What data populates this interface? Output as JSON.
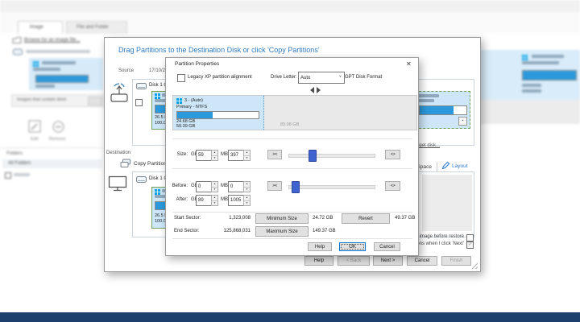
{
  "icons": {
    "close": "✕",
    "chevron": "∨",
    "shrink": "><",
    "grow": "<>",
    "check": "✓",
    "up": "▴",
    "down": "▾"
  },
  "background": {
    "tabs": {
      "image": "Image",
      "file_and_folder": "File and Folder"
    },
    "browse_link": "Browse for an image file...",
    "filter_bar": "Images that contain drive",
    "toolbar": {
      "edit": "Edit",
      "remove": "Remove"
    },
    "folders_header": "Folders",
    "folders_item": "All Folders"
  },
  "wizard": {
    "title": "Drag Partitions to the Destination Disk or click 'Copy Partitions'",
    "source_label": "Source",
    "timestamp": "17/10/2022 11:06",
    "source_disk": "Disk 1 GPT",
    "destination_label": "Destination",
    "copy_link": "Copy Partitions",
    "destination_disk": "Disk 1 GPT",
    "tile": {
      "used": "26.5 MB",
      "total": "100.0 MB"
    },
    "erase_link": "Erase target disk...",
    "fill_space": "Fill Space",
    "layout_tab": "Layout",
    "verify_label": "Verify image before restore",
    "copy_on_next_label": "Copy selected partitions when I click 'Next'",
    "buttons": {
      "help": "Help",
      "back": "< Back",
      "next": "Next >",
      "cancel": "Cancel",
      "finish": "Finish"
    }
  },
  "pp": {
    "title": "Partition Properties",
    "legacy_label": "Legacy XP partition alignment",
    "drive_letter_label": "Drive Letter:",
    "drive_letter_value": "Auto",
    "format_label": "GPT Disk Format",
    "partition": {
      "name": "3 - (Auto)",
      "type": "Primary - NTFS",
      "used": "24.68 GB",
      "size": "59.39 GB",
      "after_free": "89.98 GB"
    },
    "size_row": {
      "label": "Size:",
      "gb_label": "GB",
      "gb": "59",
      "mb_label": "MB",
      "mb": "397"
    },
    "before_row": {
      "label": "Before:",
      "gb_label": "GB",
      "gb": "0",
      "mb_label": "MB",
      "mb": "0"
    },
    "after_row": {
      "label": "After:",
      "gb_label": "GB",
      "gb": "89",
      "mb_label": "MB",
      "mb": "1005"
    },
    "sectors": {
      "start_label": "Start Sector:",
      "start": "1,323,008",
      "end_label": "End Sector:",
      "end": "125,868,031"
    },
    "min_button": "Minimum Size",
    "min_value": "24.72 GB",
    "max_button": "Maximum Size",
    "max_value": "149.37 GB",
    "revert_button": "Revert",
    "revert_value": "49.37 GB",
    "buttons": {
      "help": "Help",
      "ok": "OK",
      "cancel": "Cancel"
    }
  }
}
